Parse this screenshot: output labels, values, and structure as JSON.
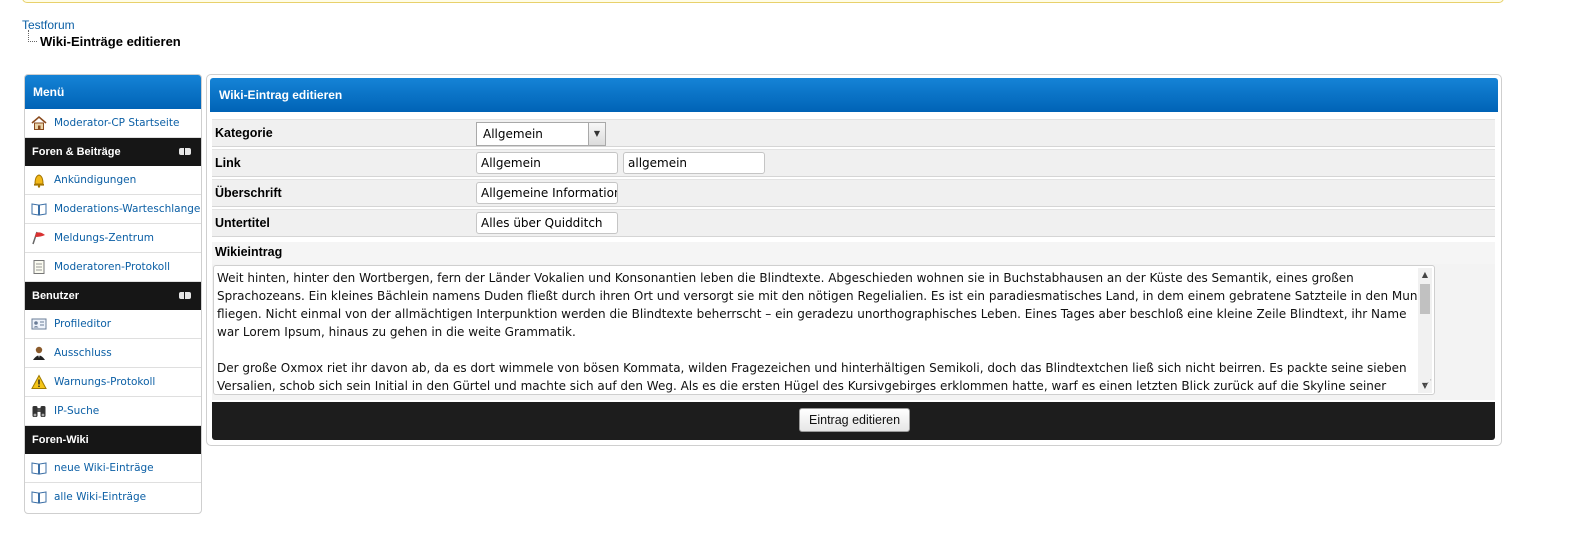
{
  "breadcrumb": {
    "root": "Testforum",
    "current": "Wiki-Einträge editieren"
  },
  "sidebar": {
    "title": "Menü",
    "top_items": [
      {
        "label": "Moderator-CP Startseite",
        "icon": "home-icon"
      }
    ],
    "categories": [
      {
        "title": "Foren & Beiträge",
        "items": [
          {
            "label": "Ankündigungen",
            "icon": "bell-icon"
          },
          {
            "label": "Moderations-Warteschlange",
            "icon": "book-icon"
          },
          {
            "label": "Meldungs-Zentrum",
            "icon": "flag-icon"
          },
          {
            "label": "Moderatoren-Protokoll",
            "icon": "notepad-icon"
          }
        ]
      },
      {
        "title": "Benutzer",
        "items": [
          {
            "label": "Profileditor",
            "icon": "id-card-icon"
          },
          {
            "label": "Ausschluss",
            "icon": "user-ban-icon"
          },
          {
            "label": "Warnungs-Protokoll",
            "icon": "warning-icon"
          },
          {
            "label": "IP-Suche",
            "icon": "binoculars-icon"
          }
        ]
      },
      {
        "title": "Foren-Wiki",
        "items": [
          {
            "label": "neue Wiki-Einträge",
            "icon": "book-icon"
          },
          {
            "label": "alle Wiki-Einträge",
            "icon": "book-icon"
          }
        ]
      }
    ]
  },
  "form": {
    "title": "Wiki-Eintrag editieren",
    "kategorie": {
      "label": "Kategorie",
      "selected": "Allgemein"
    },
    "link": {
      "label": "Link",
      "value1": "Allgemein",
      "value2": "allgemein"
    },
    "ueberschrift": {
      "label": "Überschrift",
      "value": "Allgemeine Informationen"
    },
    "untertitel": {
      "label": "Untertitel",
      "value": "Alles über Quidditch"
    },
    "wikieintrag": {
      "label": "Wikieintrag",
      "paragraph1": "Weit hinten, hinter den Wortbergen, fern der Länder Vokalien und Konsonantien leben die Blindtexte. Abgeschieden wohnen sie in Buchstabhausen an der Küste des Semantik, eines großen Sprachozeans. Ein kleines Bächlein namens Duden fließt durch ihren Ort und versorgt sie mit den nötigen Regelialien. Es ist ein paradiesmatisches Land, in dem einem gebratene Satzteile in den Mund fliegen. Nicht einmal von der allmächtigen Interpunktion werden die Blindtexte beherrscht – ein geradezu unorthographisches Leben. Eines Tages aber beschloß eine kleine Zeile Blindtext, ihr Name war Lorem Ipsum, hinaus zu gehen in die weite Grammatik.",
      "paragraph2": "Der große Oxmox riet ihr davon ab, da es dort wimmele von bösen Kommata, wilden Fragezeichen und hinterhältigen Semikoli, doch das Blindtextchen ließ sich nicht beirren. Es packte seine sieben Versalien, schob sich sein Initial in den Gürtel und machte sich auf den Weg. Als es die ersten Hügel des Kursivgebirges erklommen hatte, warf es einen letzten Blick zurück auf die Skyline seiner Heimatstadt"
    },
    "submit_label": "Eintrag editieren"
  },
  "colors": {
    "header_blue": "#0a74c9",
    "link": "#0b5fa5",
    "category_bar": "#161616"
  }
}
